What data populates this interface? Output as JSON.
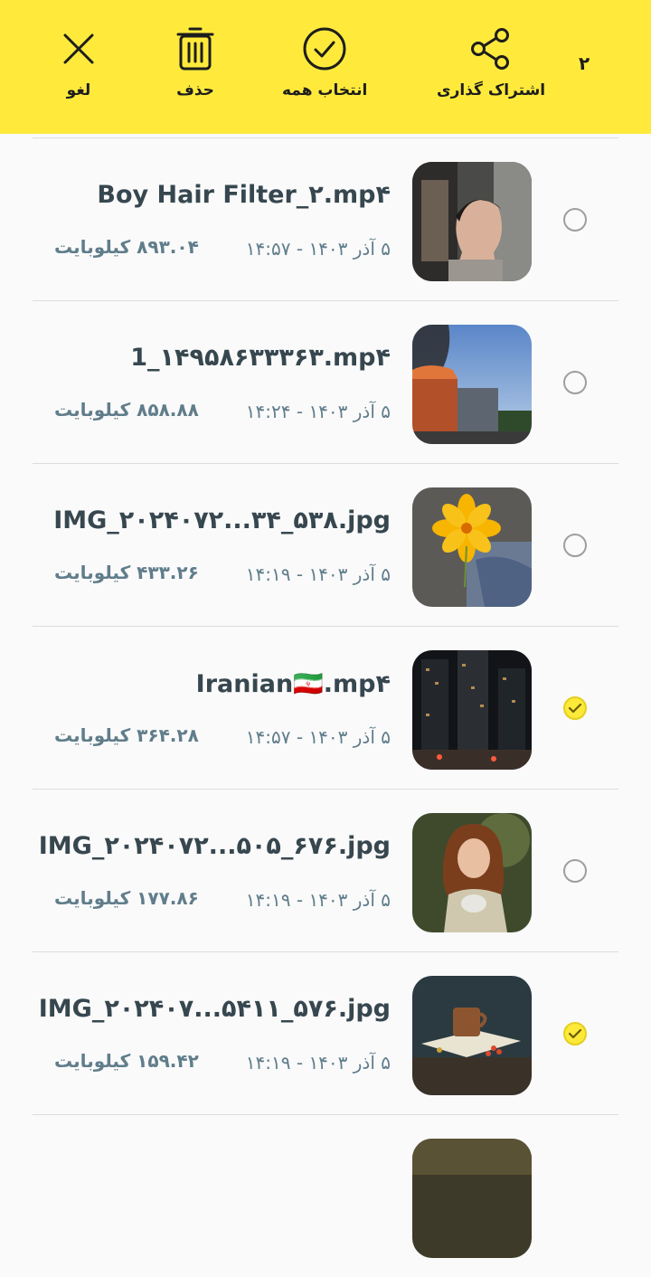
{
  "toolbar": {
    "selected_count": "۲",
    "share_label": "اشتراک گذاری",
    "select_all_label": "انتخاب همه",
    "delete_label": "حذف",
    "cancel_label": "لغو"
  },
  "colors": {
    "accent": "#ffea3c",
    "check": "#fde93a",
    "title": "#37474f",
    "meta": "#607d8b"
  },
  "files": [
    {
      "name": "Boy Hair Filter_۲.mp۴",
      "date": "۵ آذر ۱۴۰۳ - ۱۴:۵۷",
      "size": "۸۹۳.۰۴ کیلوبایت",
      "selected": false
    },
    {
      "name": "1_۱۴۹۵۸۶۳۳۳۶۳.mp۴",
      "date": "۵ آذر ۱۴۰۳ - ۱۴:۲۴",
      "size": "۸۵۸.۸۸ کیلوبایت",
      "selected": false
    },
    {
      "name": "IMG_۲۰۲۴۰۷۲...۳۴_۵۳۸.jpg",
      "date": "۵ آذر ۱۴۰۳ - ۱۴:۱۹",
      "size": "۴۳۳.۲۶ کیلوبایت",
      "selected": false
    },
    {
      "name": "Iranian🇮🇷.mp۴",
      "date": "۵ آذر ۱۴۰۳ - ۱۴:۵۷",
      "size": "۳۶۴.۲۸ کیلوبایت",
      "selected": true
    },
    {
      "name": "IMG_۲۰۲۴۰۷۲...۵۰۵_۶۷۶.jpg",
      "date": "۵ آذر ۱۴۰۳ - ۱۴:۱۹",
      "size": "۱۷۷.۸۶ کیلوبایت",
      "selected": false
    },
    {
      "name": "IMG_۲۰۲۴۰۷...۵۴۱۱_۵۷۶.jpg",
      "date": "۵ آذر ۱۴۰۳ - ۱۴:۱۹",
      "size": "۱۵۹.۴۲ کیلوبایت",
      "selected": true
    }
  ]
}
